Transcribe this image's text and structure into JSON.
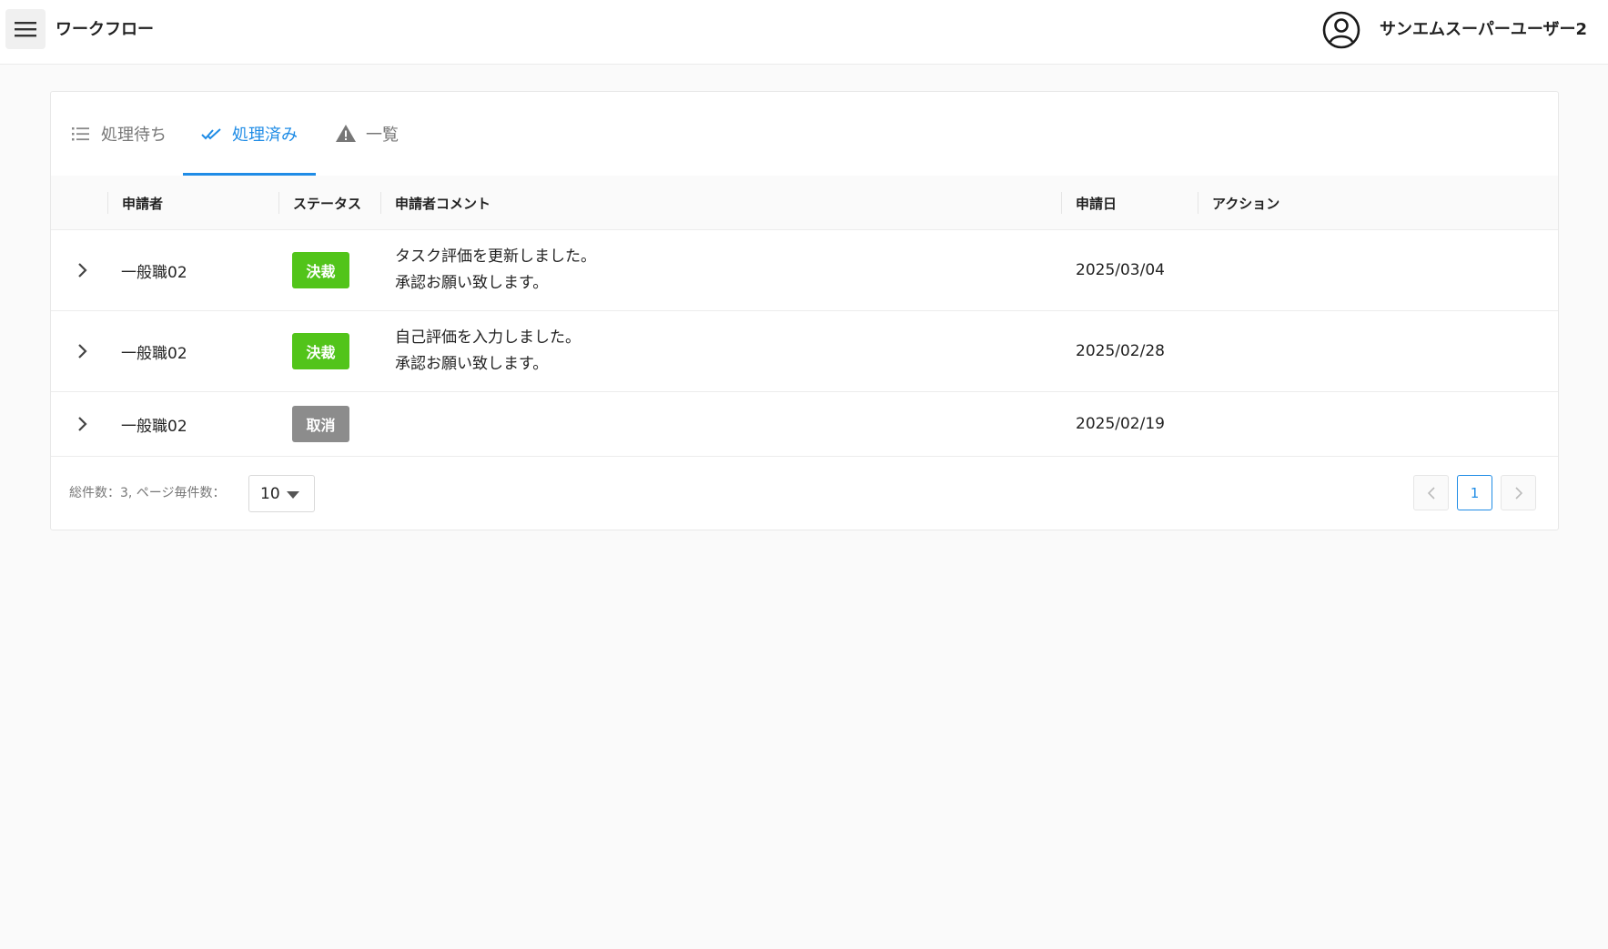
{
  "header": {
    "app_title": "ワークフロー",
    "user_name": "サンエムスーパーユーザー2",
    "icons": {
      "menu": "hamburger-icon",
      "user": "user-circle-icon"
    }
  },
  "tabs": [
    {
      "label": "処理待ち",
      "icon": "list-icon",
      "active": false
    },
    {
      "label": "処理済み",
      "icon": "double-check-icon",
      "active": true
    },
    {
      "label": "一覧",
      "icon": "warning-triangle-icon",
      "active": false
    }
  ],
  "table": {
    "columns": {
      "applicant": "申請者",
      "status": "ステータス",
      "comment": "申請者コメント",
      "date": "申請日",
      "action": "アクション"
    },
    "rows": [
      {
        "applicant": "一般職02",
        "status": "決裁",
        "status_color": "#52c41a",
        "comment_line1": "タスク評価を更新しました。",
        "comment_line2": "承認お願い致します。",
        "date": "2025/03/04"
      },
      {
        "applicant": "一般職02",
        "status": "決裁",
        "status_color": "#52c41a",
        "comment_line1": "自己評価を入力しました。",
        "comment_line2": "承認お願い致します。",
        "date": "2025/02/28"
      },
      {
        "applicant": "一般職02",
        "status": "取消",
        "status_color": "#8c8c8c",
        "comment_line1": "",
        "comment_line2": "",
        "date": "2025/02/19"
      }
    ]
  },
  "pagination": {
    "total_text": "総件数：3,  ページ毎件数：",
    "page_size": "10",
    "current_page": "1"
  },
  "colors": {
    "accent": "#1f8ce6",
    "approved": "#52c41a",
    "cancelled": "#8c8c8c"
  }
}
